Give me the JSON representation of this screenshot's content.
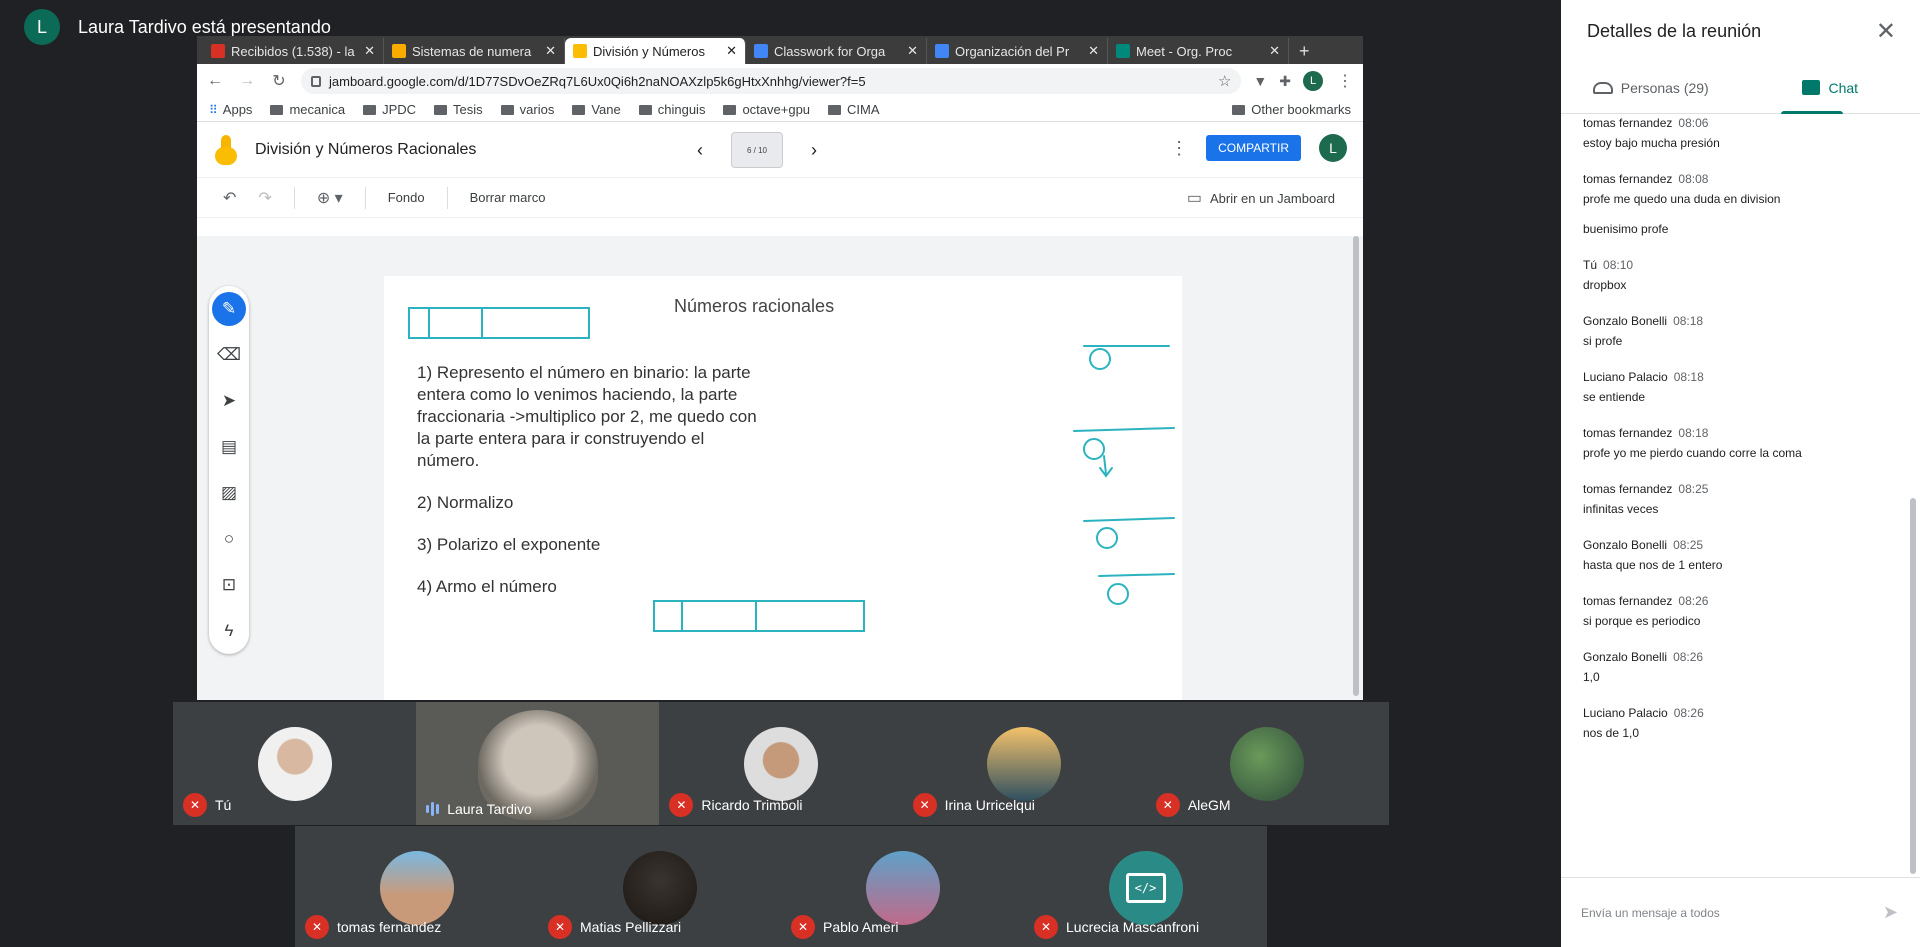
{
  "presenter": {
    "initial": "L",
    "text": "Laura Tardivo está presentando"
  },
  "browser": {
    "tabs": [
      {
        "title": "Recibidos (1.538) - la",
        "color": "#d93025"
      },
      {
        "title": "Sistemas de numera",
        "color": "#f9ab00"
      },
      {
        "title": "División y Números",
        "color": "#fbbc04",
        "active": true
      },
      {
        "title": "Classwork for Orga",
        "color": "#4285f4"
      },
      {
        "title": "Organización del Pr",
        "color": "#4285f4"
      },
      {
        "title": "Meet - Org. Proc",
        "color": "#00897b"
      }
    ],
    "tab_close": "✕",
    "new_tab": "+",
    "url": "jamboard.google.com/d/1D77SDvOeZRq7L6Ux0Qi6h2naNOAXzlp5k6gHtxXnhhg/viewer?f=5",
    "profile_initial": "L",
    "bookmarks": [
      "mecanica",
      "JPDC",
      "Tesis",
      "varios",
      "Vane",
      "chinguis",
      "octave+gpu",
      "CIMA"
    ],
    "apps_label": "Apps",
    "other_bookmarks": "Other bookmarks"
  },
  "jamboard": {
    "title": "División y Números Racionales",
    "frame_indicator": "6 / 10",
    "share_label": "COMPARTIR",
    "user_initial": "L",
    "fondo_label": "Fondo",
    "borrar_label": "Borrar marco",
    "open_label": "Abrir en un Jamboard",
    "frame": {
      "title": "Números racionales",
      "steps": [
        "1) Represento el número en binario: la parte entera como lo venimos haciendo, la parte fraccionaria ->multiplico por 2, me quedo con la parte entera para ir construyendo el número.",
        "2) Normalizo",
        "3) Polarizo el exponente",
        "4) Armo el número"
      ]
    }
  },
  "participants_row1": [
    {
      "name": "Tú",
      "muted": true
    },
    {
      "name": "Laura Tardivo",
      "muted": false
    },
    {
      "name": "Ricardo Trimboli",
      "muted": true
    },
    {
      "name": "Irina Urricelqui",
      "muted": true
    },
    {
      "name": "AleGM",
      "muted": true
    }
  ],
  "participants_row2": [
    {
      "name": "tomas fernandez",
      "muted": true
    },
    {
      "name": "Matias Pellizzari",
      "muted": true
    },
    {
      "name": "Pablo Ameri",
      "muted": true
    },
    {
      "name": "Lucrecia Mascanfroni",
      "muted": true
    }
  ],
  "panel": {
    "title": "Detalles de la reunión",
    "tab_people": "Personas (29)",
    "tab_chat": "Chat",
    "messages": [
      {
        "sender": "tomas fernandez",
        "time": "08:06",
        "lines": [
          "estoy bajo mucha presión"
        ]
      },
      {
        "sender": "tomas fernandez",
        "time": "08:08",
        "lines": [
          "profe  me quedo una duda en division",
          "buenisimo profe"
        ]
      },
      {
        "sender": "Tú",
        "time": "08:10",
        "lines": [
          "dropbox"
        ]
      },
      {
        "sender": "Gonzalo Bonelli",
        "time": "08:18",
        "lines": [
          "si profe"
        ]
      },
      {
        "sender": "Luciano Palacio",
        "time": "08:18",
        "lines": [
          "se entiende"
        ]
      },
      {
        "sender": "tomas fernandez",
        "time": "08:18",
        "lines": [
          "profe yo me pierdo cuando corre la coma"
        ]
      },
      {
        "sender": "tomas fernandez",
        "time": "08:25",
        "lines": [
          "infinitas veces"
        ]
      },
      {
        "sender": "Gonzalo Bonelli",
        "time": "08:25",
        "lines": [
          "hasta que nos de 1 entero"
        ]
      },
      {
        "sender": "tomas fernandez",
        "time": "08:26",
        "lines": [
          "si porque es periodico"
        ]
      },
      {
        "sender": "Gonzalo Bonelli",
        "time": "08:26",
        "lines": [
          "1,0"
        ]
      },
      {
        "sender": "Luciano Palacio",
        "time": "08:26",
        "lines": [
          "nos de 1,0"
        ]
      }
    ],
    "composer_placeholder": "Envía un mensaje a todos"
  }
}
